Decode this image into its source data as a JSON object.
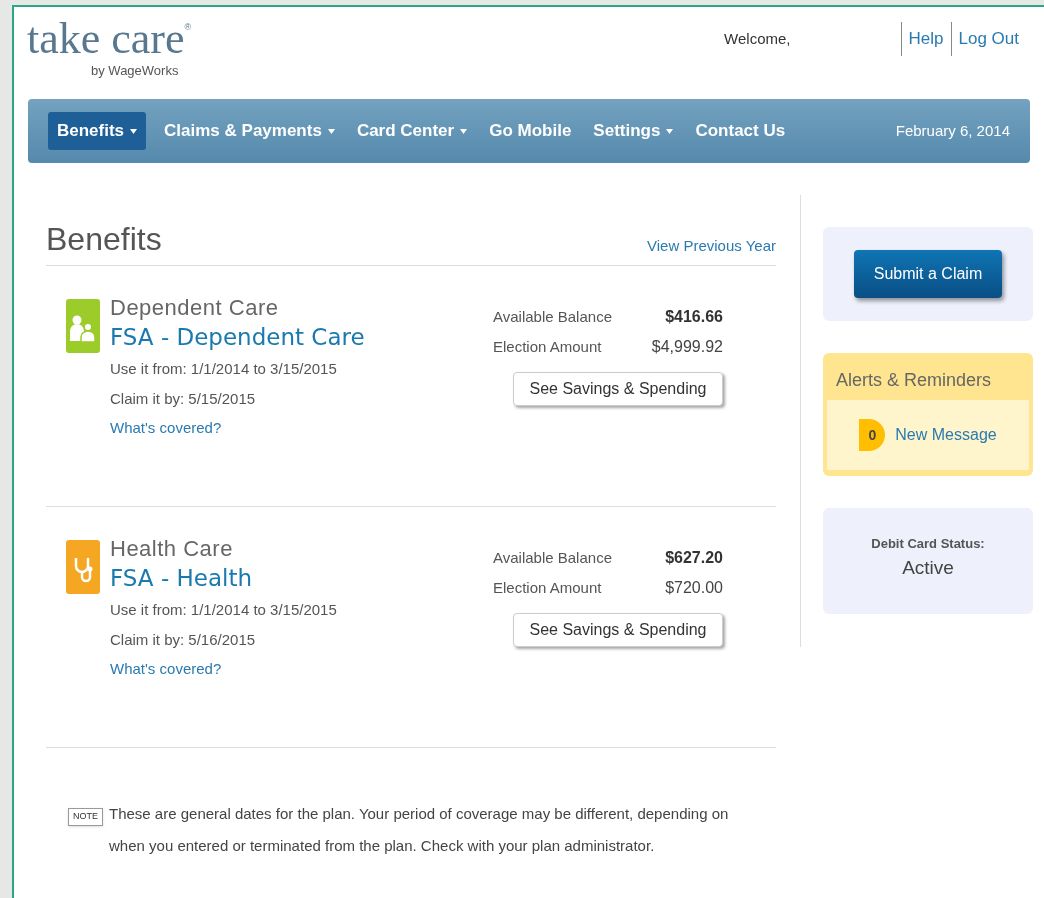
{
  "logo": {
    "name": "take care",
    "mark": "®",
    "byline": "by WageWorks"
  },
  "header": {
    "welcome": "Welcome,",
    "links": [
      "Help",
      "Log Out"
    ]
  },
  "nav": {
    "items": [
      {
        "label": "Benefits",
        "dropdown": true,
        "selected": true
      },
      {
        "label": "Claims & Payments",
        "dropdown": true,
        "selected": false
      },
      {
        "label": "Card Center",
        "dropdown": true,
        "selected": false
      },
      {
        "label": "Go Mobile",
        "dropdown": false,
        "selected": false
      },
      {
        "label": "Settings",
        "dropdown": true,
        "selected": false
      },
      {
        "label": "Contact Us",
        "dropdown": false,
        "selected": false
      }
    ],
    "date": "February 6, 2014"
  },
  "page_title": "Benefits",
  "view_previous_year": "View Previous Year",
  "plans": [
    {
      "kind": "dependent",
      "category": "Dependent Care",
      "name": "FSA - Dependent Care",
      "use_it": "Use it from: 1/1/2014 to 3/15/2015",
      "claim_by": "Claim it by: 5/15/2015",
      "covered_link": "What's covered?",
      "balance_label": "Available Balance",
      "balance": "$416.66",
      "election_label": "Election Amount",
      "election": "$4,999.92",
      "button": "See Savings & Spending"
    },
    {
      "kind": "health",
      "category": "Health Care",
      "name": "FSA - Health",
      "use_it": "Use it from: 1/1/2014 to 3/15/2015",
      "claim_by": "Claim it by: 5/16/2015",
      "covered_link": "What's covered?",
      "balance_label": "Available Balance",
      "balance": "$627.20",
      "election_label": "Election Amount",
      "election": "$720.00",
      "button": "See Savings & Spending"
    }
  ],
  "note": {
    "tag": "NOTE",
    "text": "These are general dates for the plan. Your period of coverage may be different, depending on when you entered or terminated from the plan. Check with your plan administrator."
  },
  "sidebar": {
    "submit_button": "Submit a Claim",
    "alerts": {
      "title": "Alerts & Reminders",
      "count": "0",
      "label": "New Message"
    },
    "card_status": {
      "label": "Debit Card Status:",
      "value": "Active"
    }
  }
}
